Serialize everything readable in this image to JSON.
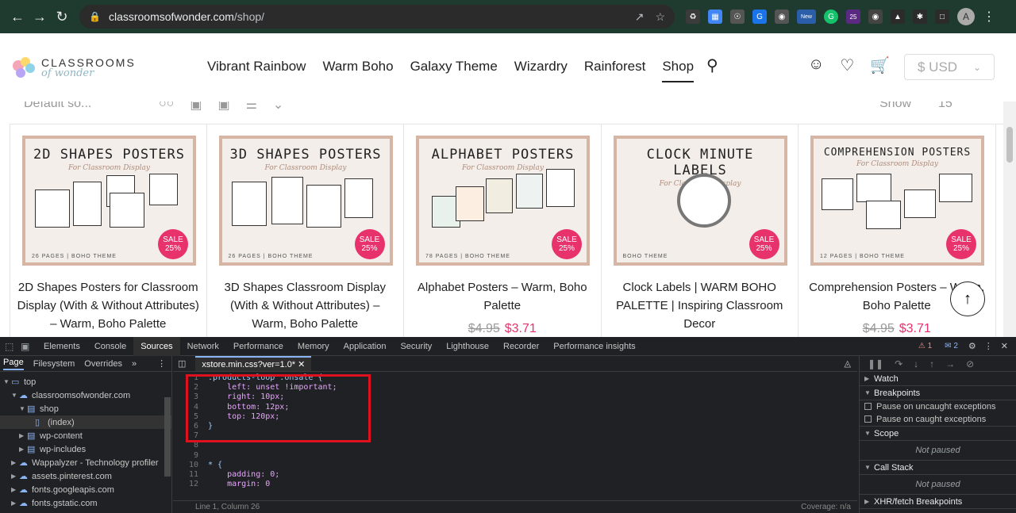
{
  "browser": {
    "url_host": "classroomsofwonder.com",
    "url_path": "/shop/",
    "profile_initial": "A",
    "ext_badge_new": "New",
    "ext_badge_count": "25"
  },
  "site": {
    "logo_top": "CLASSROOMS",
    "logo_bottom": "of wonder",
    "nav": [
      "Vibrant Rainbow",
      "Warm Boho",
      "Galaxy Theme",
      "Wizardry",
      "Rainforest",
      "Shop"
    ],
    "currency": "$ USD"
  },
  "toolbar": {
    "sort_label": "Default so...",
    "show_label": "Show",
    "show_value": "15"
  },
  "products": [
    {
      "thumb_title": "2D SHAPES POSTERS",
      "thumb_sub": "For Classroom Display",
      "thumb_foot": "26 PAGES | BOHO THEME",
      "title": "2D Shapes Posters for Classroom Display (With & Without Attributes) – Warm, Boho Palette",
      "old_price": "",
      "new_price": ""
    },
    {
      "thumb_title": "3D SHAPES POSTERS",
      "thumb_sub": "For Classroom Display",
      "thumb_foot": "26 PAGES | BOHO THEME",
      "title": "3D Shapes Classroom Display (With & Without Attributes) – Warm, Boho Palette",
      "old_price": "",
      "new_price": ""
    },
    {
      "thumb_title": "ALPHABET POSTERS",
      "thumb_sub": "For Classroom Display",
      "thumb_foot": "78 PAGES | BOHO THEME",
      "title": "Alphabet Posters – Warm, Boho Palette",
      "old_price": "$4.95",
      "new_price": "$3.71"
    },
    {
      "thumb_title": "CLOCK MINUTE LABELS",
      "thumb_sub": "For Classroom Display",
      "thumb_foot": "BOHO THEME",
      "title": "Clock Labels | WARM BOHO PALETTE | Inspiring Classroom Decor",
      "old_price": "",
      "new_price": ""
    },
    {
      "thumb_title": "COMPREHENSION POSTERS",
      "thumb_sub": "For Classroom Display",
      "thumb_foot": "12 PAGES | BOHO THEME",
      "title": "Comprehension Posters – Warm, Boho Palette",
      "old_price": "$4.95",
      "new_price": "$3.71"
    }
  ],
  "sale_badge": {
    "line1": "SALE",
    "line2": "25%"
  },
  "devtools": {
    "tabs": [
      "Elements",
      "Console",
      "Sources",
      "Network",
      "Performance",
      "Memory",
      "Application",
      "Security",
      "Lighthouse",
      "Recorder",
      "Performance insights"
    ],
    "errors": "1",
    "messages": "2",
    "subtabs": [
      "Page",
      "Filesystem",
      "Overrides"
    ],
    "tree": [
      {
        "label": "top",
        "depth": 0,
        "icon": "frame"
      },
      {
        "label": "classroomsofwonder.com",
        "depth": 1,
        "icon": "cloud"
      },
      {
        "label": "shop",
        "depth": 2,
        "icon": "folder"
      },
      {
        "label": "(index)",
        "depth": 3,
        "icon": "file"
      },
      {
        "label": "wp-content",
        "depth": 2,
        "icon": "folder"
      },
      {
        "label": "wp-includes",
        "depth": 2,
        "icon": "folder"
      },
      {
        "label": "Wappalyzer - Technology profiler",
        "depth": 1,
        "icon": "cloud"
      },
      {
        "label": "assets.pinterest.com",
        "depth": 1,
        "icon": "cloud"
      },
      {
        "label": "fonts.googleapis.com",
        "depth": 1,
        "icon": "cloud"
      },
      {
        "label": "fonts.gstatic.com",
        "depth": 1,
        "icon": "cloud"
      }
    ],
    "editor_tab": "xstore.min.css?ver=1.0*",
    "code_lines": [
      ".products-loop .onsale {",
      "    left: unset !important;",
      "    right: 10px;",
      "    bottom: 12px;",
      "    top: 120px;",
      "}",
      "",
      "",
      "",
      "* {",
      "    padding: 0;",
      "    margin: 0"
    ],
    "status_pos": "Line 1, Column 26",
    "status_cov": "Coverage: n/a",
    "debug": {
      "watch": "Watch",
      "breakpoints": "Breakpoints",
      "pause_uncaught": "Pause on uncaught exceptions",
      "pause_caught": "Pause on caught exceptions",
      "scope": "Scope",
      "not_paused": "Not paused",
      "call_stack": "Call Stack",
      "xhr": "XHR/fetch Breakpoints"
    }
  }
}
